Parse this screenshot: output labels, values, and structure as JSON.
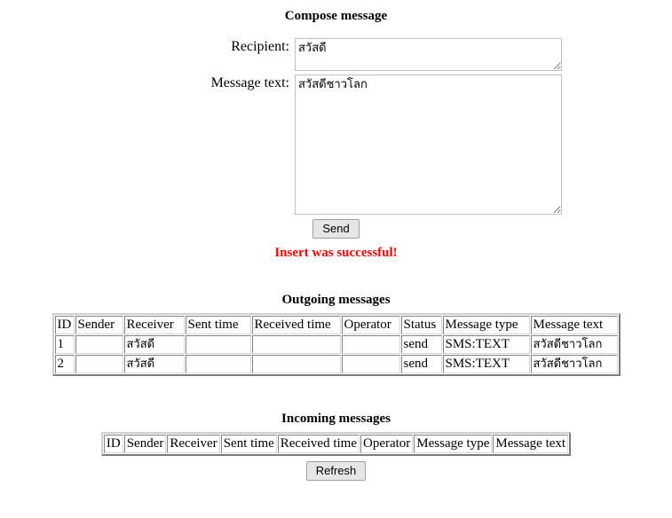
{
  "compose": {
    "heading": "Compose message",
    "recipient_label": "Recipient:",
    "recipient_value": "สวัสดี",
    "recipient_placeholder": "",
    "message_label": "Message text:",
    "message_value": "สวัสดีชาวโลก",
    "message_placeholder": "",
    "send_label": "Send",
    "status_message": "Insert was successful!",
    "status_color": "#ff0000"
  },
  "outgoing": {
    "heading": "Outgoing messages",
    "columns": [
      "ID",
      "Sender",
      "Receiver",
      "Sent time",
      "Received time",
      "Operator",
      "Status",
      "Message type",
      "Message text"
    ],
    "rows": [
      {
        "id": "1",
        "sender": "",
        "receiver": "สวัสดี",
        "sent_time": "",
        "received_time": "",
        "operator": "",
        "status": "send",
        "message_type": "SMS:TEXT",
        "message_text": "สวัสดีชาวโลก"
      },
      {
        "id": "2",
        "sender": "",
        "receiver": "สวัสดี",
        "sent_time": "",
        "received_time": "",
        "operator": "",
        "status": "send",
        "message_type": "SMS:TEXT",
        "message_text": "สวัสดีชาวโลก"
      }
    ]
  },
  "incoming": {
    "heading": "Incoming messages",
    "columns": [
      "ID",
      "Sender",
      "Receiver",
      "Sent time",
      "Received time",
      "Operator",
      "Message type",
      "Message text"
    ],
    "rows": [],
    "refresh_label": "Refresh"
  }
}
